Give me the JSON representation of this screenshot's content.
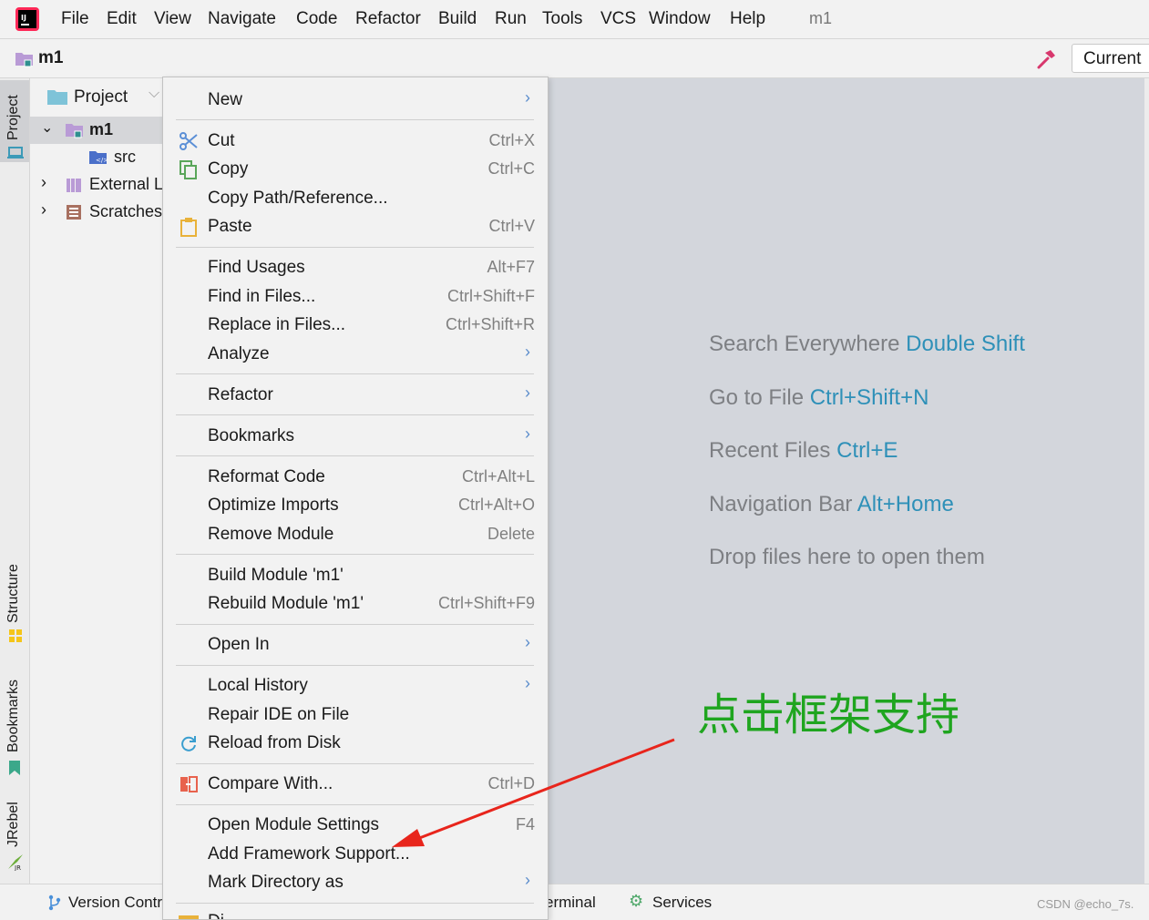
{
  "menubar": {
    "items": [
      "File",
      "Edit",
      "View",
      "Navigate",
      "Code",
      "Refactor",
      "Build",
      "Run",
      "Tools",
      "VCS",
      "Window",
      "Help"
    ],
    "project_title": "m1"
  },
  "navbar": {
    "project": "m1",
    "run_config": "Current"
  },
  "left_tabs": {
    "project": "Project",
    "structure": "Structure",
    "bookmarks": "Bookmarks",
    "jrebel": "JRebel"
  },
  "project_panel": {
    "header": "Project",
    "tree": [
      {
        "label": "m1"
      },
      {
        "label": "src"
      },
      {
        "label": "External L"
      },
      {
        "label": "Scratches"
      }
    ]
  },
  "context_menu": {
    "new": "New",
    "cut": "Cut",
    "cut_sc": "Ctrl+X",
    "copy": "Copy",
    "copy_sc": "Ctrl+C",
    "copy_path": "Copy Path/Reference...",
    "paste": "Paste",
    "paste_sc": "Ctrl+V",
    "find_usages": "Find Usages",
    "find_usages_sc": "Alt+F7",
    "find_in_files": "Find in Files...",
    "find_in_files_sc": "Ctrl+Shift+F",
    "replace_in_files": "Replace in Files...",
    "replace_in_files_sc": "Ctrl+Shift+R",
    "analyze": "Analyze",
    "refactor": "Refactor",
    "bookmarks": "Bookmarks",
    "reformat": "Reformat Code",
    "reformat_sc": "Ctrl+Alt+L",
    "optimize": "Optimize Imports",
    "optimize_sc": "Ctrl+Alt+O",
    "remove_module": "Remove Module",
    "remove_module_sc": "Delete",
    "build_module": "Build Module 'm1'",
    "rebuild_module": "Rebuild Module 'm1'",
    "rebuild_module_sc": "Ctrl+Shift+F9",
    "open_in": "Open In",
    "local_history": "Local History",
    "repair_ide": "Repair IDE on File",
    "reload": "Reload from Disk",
    "compare": "Compare With...",
    "compare_sc": "Ctrl+D",
    "module_settings": "Open Module Settings",
    "module_settings_sc": "F4",
    "add_framework": "Add Framework Support...",
    "mark_directory": "Mark Directory as",
    "partial_item": "Di"
  },
  "editor": {
    "hints": [
      {
        "text": "Search Everywhere",
        "key": "Double Shift"
      },
      {
        "text": "Go to File",
        "key": "Ctrl+Shift+N"
      },
      {
        "text": "Recent Files",
        "key": "Ctrl+E"
      },
      {
        "text": "Navigation Bar",
        "key": "Alt+Home"
      },
      {
        "text": "Drop files here to open them",
        "key": ""
      }
    ]
  },
  "bottombar": {
    "version_control": "Version Contr",
    "terminal": "erminal",
    "services": "Services",
    "watermark": "CSDN @echo_7s."
  },
  "annotation": {
    "text": "点击框架支持",
    "color": "#1fa51f"
  },
  "colors": {
    "accent_key": "#2e90b8",
    "arrow": "#e8251c"
  }
}
